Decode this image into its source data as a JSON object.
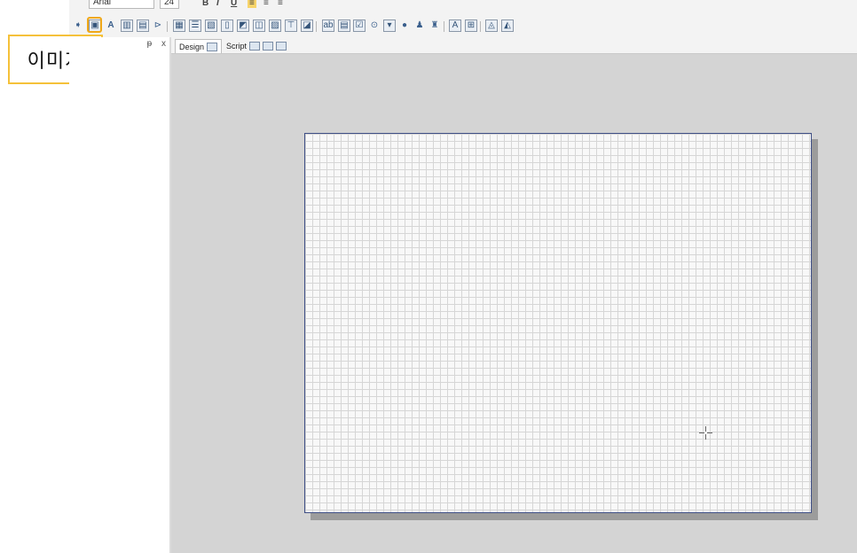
{
  "callout": {
    "label": "이미지"
  },
  "toolbar": {
    "font_name": "Arial",
    "font_size": "24",
    "format_glyphs": [
      "B",
      "I",
      "U",
      "≡",
      "≡",
      "≡"
    ],
    "tool_icons": [
      "pointer-icon",
      "image-icon",
      "text-icon",
      "barcode-icon",
      "chart-icon",
      "line-icon",
      "report-icon",
      "list-icon",
      "check-image-icon",
      "split-icon",
      "globe-icon",
      "box-icon",
      "sheet-icon",
      "filter-icon",
      "data-icon",
      "label-icon",
      "field-icon",
      "table-icon",
      "checkbox-icon",
      "radio-icon",
      "combo-icon",
      "earth-icon",
      "person-icon",
      "group-icon",
      "frame-icon",
      "grid-icon",
      "map-icon",
      "subreport-icon"
    ]
  },
  "panel": {
    "pin": "ᵽ",
    "close": "x"
  },
  "tabs": [
    {
      "label": "Design"
    },
    {
      "label": "Script"
    }
  ],
  "colors": {
    "highlight": "#f0a818",
    "callout_border": "#f5c13a",
    "canvas_border": "#3f4f86",
    "workspace": "#d4d4d4"
  }
}
